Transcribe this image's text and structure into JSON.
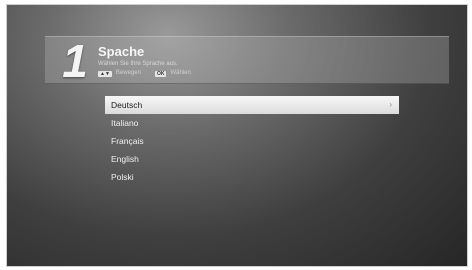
{
  "step": {
    "number": "1"
  },
  "header": {
    "title": "Spache",
    "subtitle": "Wählen Sie Ihre Sprache aus."
  },
  "hints": [
    {
      "key": "▲▼",
      "label": "Bewegen"
    },
    {
      "key": "OK",
      "label": "Wählen"
    }
  ],
  "languages": {
    "items": [
      "Deutsch",
      "Italiano",
      "Français",
      "English",
      "Polski"
    ],
    "selected_index": 0
  },
  "icons": {
    "selected_chevron": "chevron-right-icon"
  }
}
